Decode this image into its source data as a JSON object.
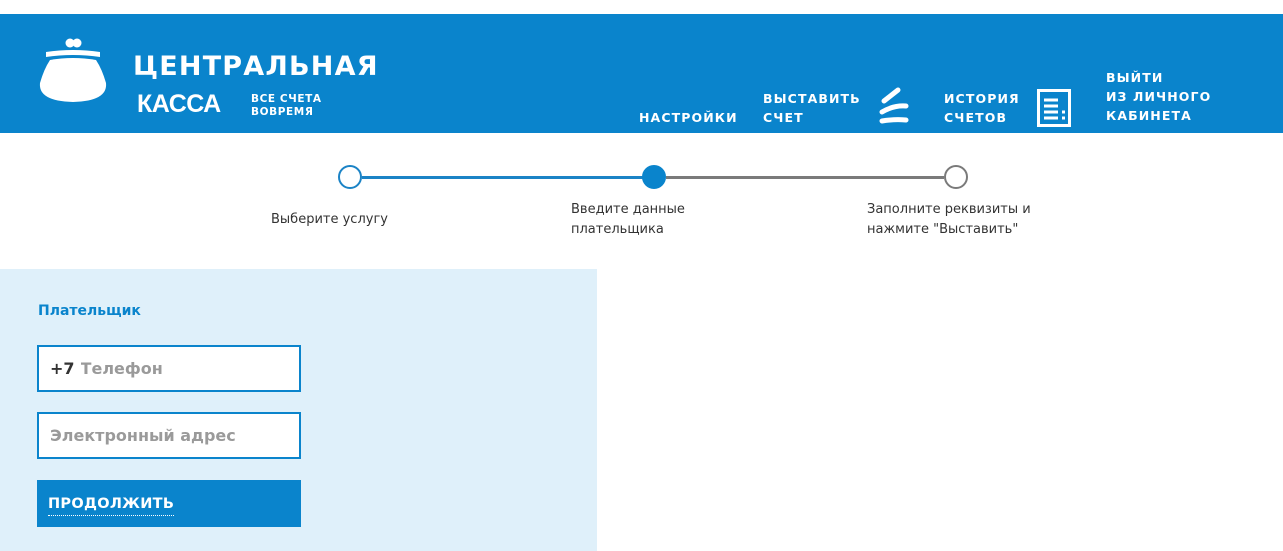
{
  "header": {
    "brand_line1": "ЦЕНТРАЛЬНАЯ",
    "brand_line2": "КАССА",
    "tagline_line1": "ВСЕ СЧЕТА",
    "tagline_line2": "ВОВРЕМЯ",
    "logo_icon": "purse-icon",
    "nav": {
      "settings": "НАСТРОЙКИ",
      "invoice_line1": "ВЫСТАВИТЬ",
      "invoice_line2": "СЧЕТ",
      "invoice_icon": "coins-icon",
      "history_line1": "ИСТОРИЯ",
      "history_line2": "СЧЕТОВ",
      "history_icon": "document-icon",
      "logout_line1": "ВЫЙТИ",
      "logout_line2": "ИЗ ЛИЧНОГО",
      "logout_line3": "КАБИНЕТА"
    }
  },
  "stepper": {
    "current_step": 2,
    "steps": [
      {
        "line1": "Выберите услугу",
        "line2": ""
      },
      {
        "line1": "Введите данные",
        "line2": "плательщика"
      },
      {
        "line1": "Заполните реквизиты и",
        "line2": "нажмите \"Выставить\""
      }
    ]
  },
  "form": {
    "title": "Плательщик",
    "phone_prefix": "+7",
    "phone_placeholder": "Телефон",
    "phone_value": "",
    "email_placeholder": "Электронный адрес",
    "email_value": "",
    "submit_label": "ПРОДОЛЖИТЬ"
  },
  "colors": {
    "brand": "#0a84cc",
    "panel_bg": "#dff0fa",
    "step_inactive": "#7a7a7a",
    "text": "#333333",
    "placeholder": "#9a9a9a"
  }
}
